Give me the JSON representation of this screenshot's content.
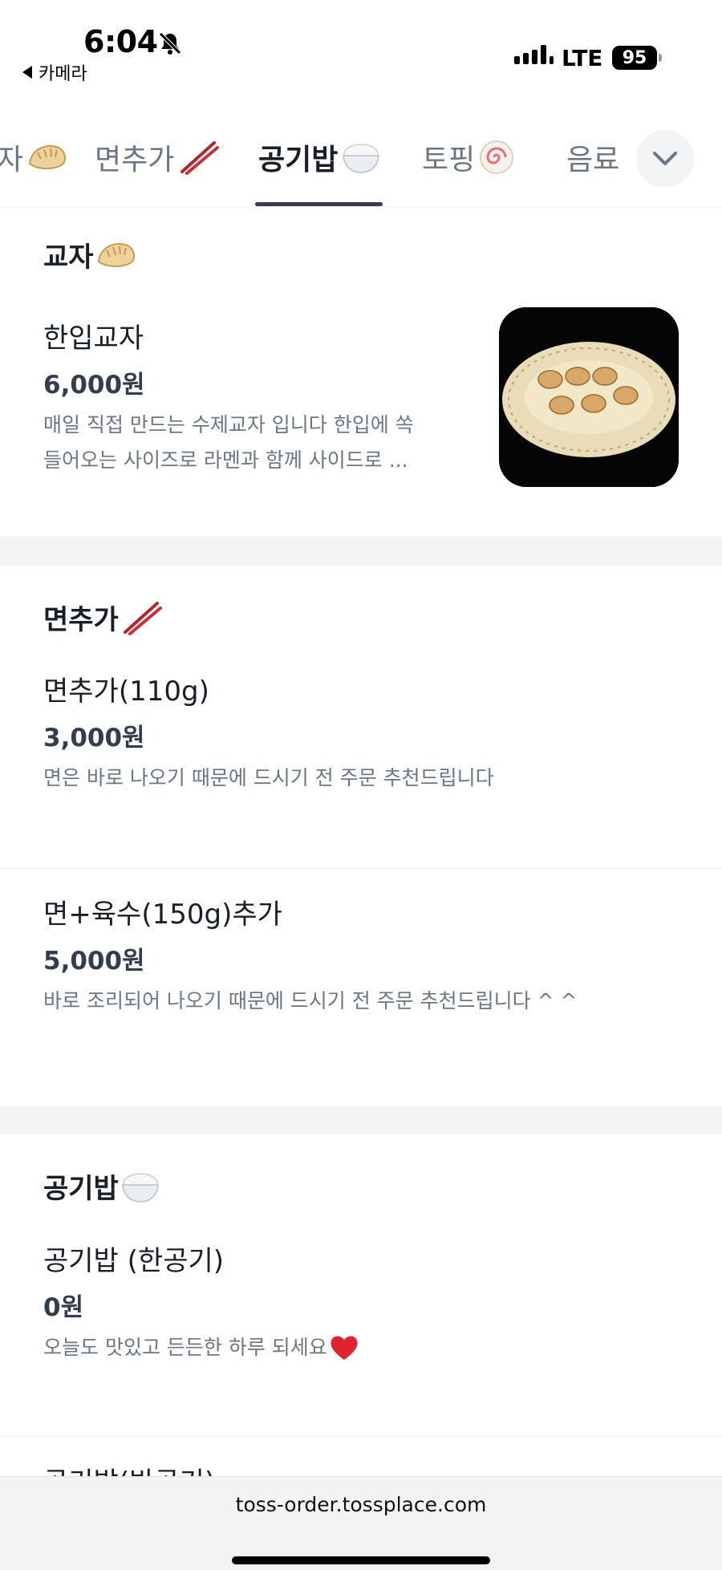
{
  "status_bar": {
    "time": "6:04",
    "back_label": "카메라",
    "network": "LTE",
    "battery": "95"
  },
  "tabs": {
    "items": [
      {
        "label": "자",
        "icon": "dumpling-icon"
      },
      {
        "label": "면추가",
        "icon": "chopsticks-icon"
      },
      {
        "label": "공기밥",
        "icon": "rice-bowl-icon"
      },
      {
        "label": "토핑",
        "icon": "fish-cake-icon"
      },
      {
        "label": "음료",
        "icon": ""
      }
    ],
    "active": "공기밥"
  },
  "sections": [
    {
      "title": "교자",
      "icon": "dumpling-icon",
      "items": [
        {
          "name": "한입교자",
          "price": "6,000원",
          "desc_line1": "매일 직접 만드는 수제교자 입니다 한입에 쏙",
          "desc_line2": "들어오는 사이즈로 라멘과 함께 사이드로 ...",
          "has_photo": true
        }
      ]
    },
    {
      "title": "면추가",
      "icon": "chopsticks-icon",
      "items": [
        {
          "name": "면추가(110g)",
          "price": "3,000원",
          "desc_line1": "면은 바로 나오기 때문에 드시기 전 주문 추천드립니다"
        },
        {
          "name": "면+육수(150g)추가",
          "price": "5,000원",
          "desc_line1": "바로 조리되어 나오기 때문에 드시기 전 주문 추천드립니다 ^ ^"
        }
      ]
    },
    {
      "title": "공기밥",
      "icon": "rice-bowl-icon",
      "items": [
        {
          "name": "공기밥 (한공기)",
          "price": "0원",
          "desc_line1": "오늘도 맛있고 든든한 하루 되세요",
          "desc_icon": "heart-icon"
        },
        {
          "name": "공기밥(반공기)"
        }
      ]
    }
  ],
  "browser": {
    "url": "toss-order.tossplace.com"
  },
  "colors": {
    "text_primary": "#191f28",
    "text_secondary": "#6b7684",
    "divider_gray": "#f2f4f6",
    "heart_red": "#e0242f"
  }
}
